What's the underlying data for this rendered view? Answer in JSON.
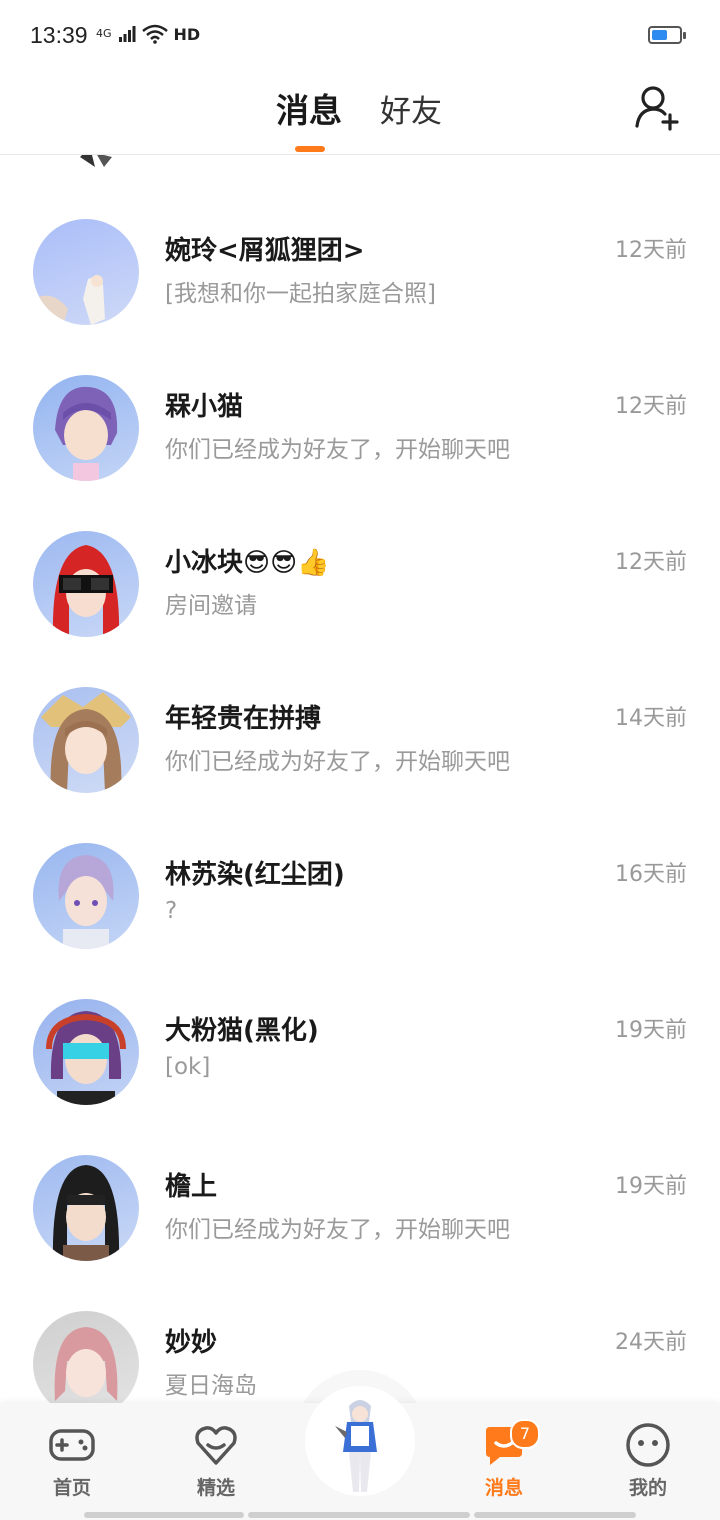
{
  "status_bar": {
    "time": "13:39",
    "network": "4G",
    "hd": "HD",
    "battery_level": 0.55
  },
  "header": {
    "tabs": [
      {
        "label": "消息",
        "active": true
      },
      {
        "label": "好友",
        "active": false
      }
    ],
    "add_friend_icon": "add-user-icon",
    "accent": "#ff7a1a"
  },
  "messages": [
    {
      "name": "婉玲<屑狐狸团>",
      "preview": "[我想和你一起拍家庭合照]",
      "time": "12天前",
      "avatar_bg": "#b7c9f5"
    },
    {
      "name": "槑小猫",
      "preview": "你们已经成为好友了，开始聊天吧",
      "time": "12天前",
      "avatar_bg": "#9fbdf0"
    },
    {
      "name": "小冰块😎😎👍",
      "preview": "房间邀请",
      "time": "12天前",
      "avatar_bg": "#a9c3f3"
    },
    {
      "name": "年轻贵在拼搏",
      "preview": "你们已经成为好友了，开始聊天吧",
      "time": "14天前",
      "avatar_bg": "#b4c6ef"
    },
    {
      "name": "林苏染(红尘团)",
      "preview": "?",
      "time": "16天前",
      "avatar_bg": "#a6bff2"
    },
    {
      "name": "大粉猫(黑化)",
      "preview": "[ok]",
      "time": "19天前",
      "avatar_bg": "#a3bdf0"
    },
    {
      "name": "檐上",
      "preview": "你们已经成为好友了，开始聊天吧",
      "time": "19天前",
      "avatar_bg": "#aac2f2"
    },
    {
      "name": "妙妙",
      "preview": "夏日海岛",
      "time": "24天前",
      "avatar_bg": "#d6d6d6"
    }
  ],
  "bottom_nav": {
    "items": [
      {
        "label": "首页",
        "icon": "gamepad-icon",
        "active": false
      },
      {
        "label": "精选",
        "icon": "heart-icon",
        "active": false
      },
      {
        "label": "消息",
        "icon": "chat-icon",
        "active": true,
        "badge": "7"
      },
      {
        "label": "我的",
        "icon": "smiley-icon",
        "active": false
      }
    ]
  }
}
